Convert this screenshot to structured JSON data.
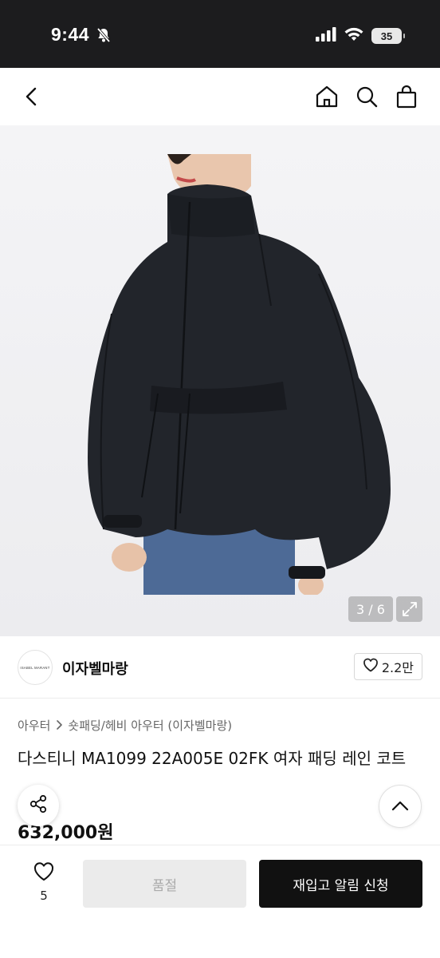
{
  "status_bar": {
    "time": "9:44",
    "battery": "35"
  },
  "image": {
    "counter": "3 / 6"
  },
  "seller": {
    "logo_text": "ISABEL MARANT",
    "name": "이자벨마랑",
    "likes": "2.2만"
  },
  "breadcrumb": {
    "parent": "아우터",
    "child": "숏패딩/헤비 아우터 (이자벨마랑)"
  },
  "product": {
    "title": "다스티니 MA1099 22A005E 02FK 여자 패딩 레인 코트",
    "price": "632,000원"
  },
  "bottom_bar": {
    "wish_count": "5",
    "soldout_label": "품절",
    "restock_label": "재입고 알림 신청"
  }
}
